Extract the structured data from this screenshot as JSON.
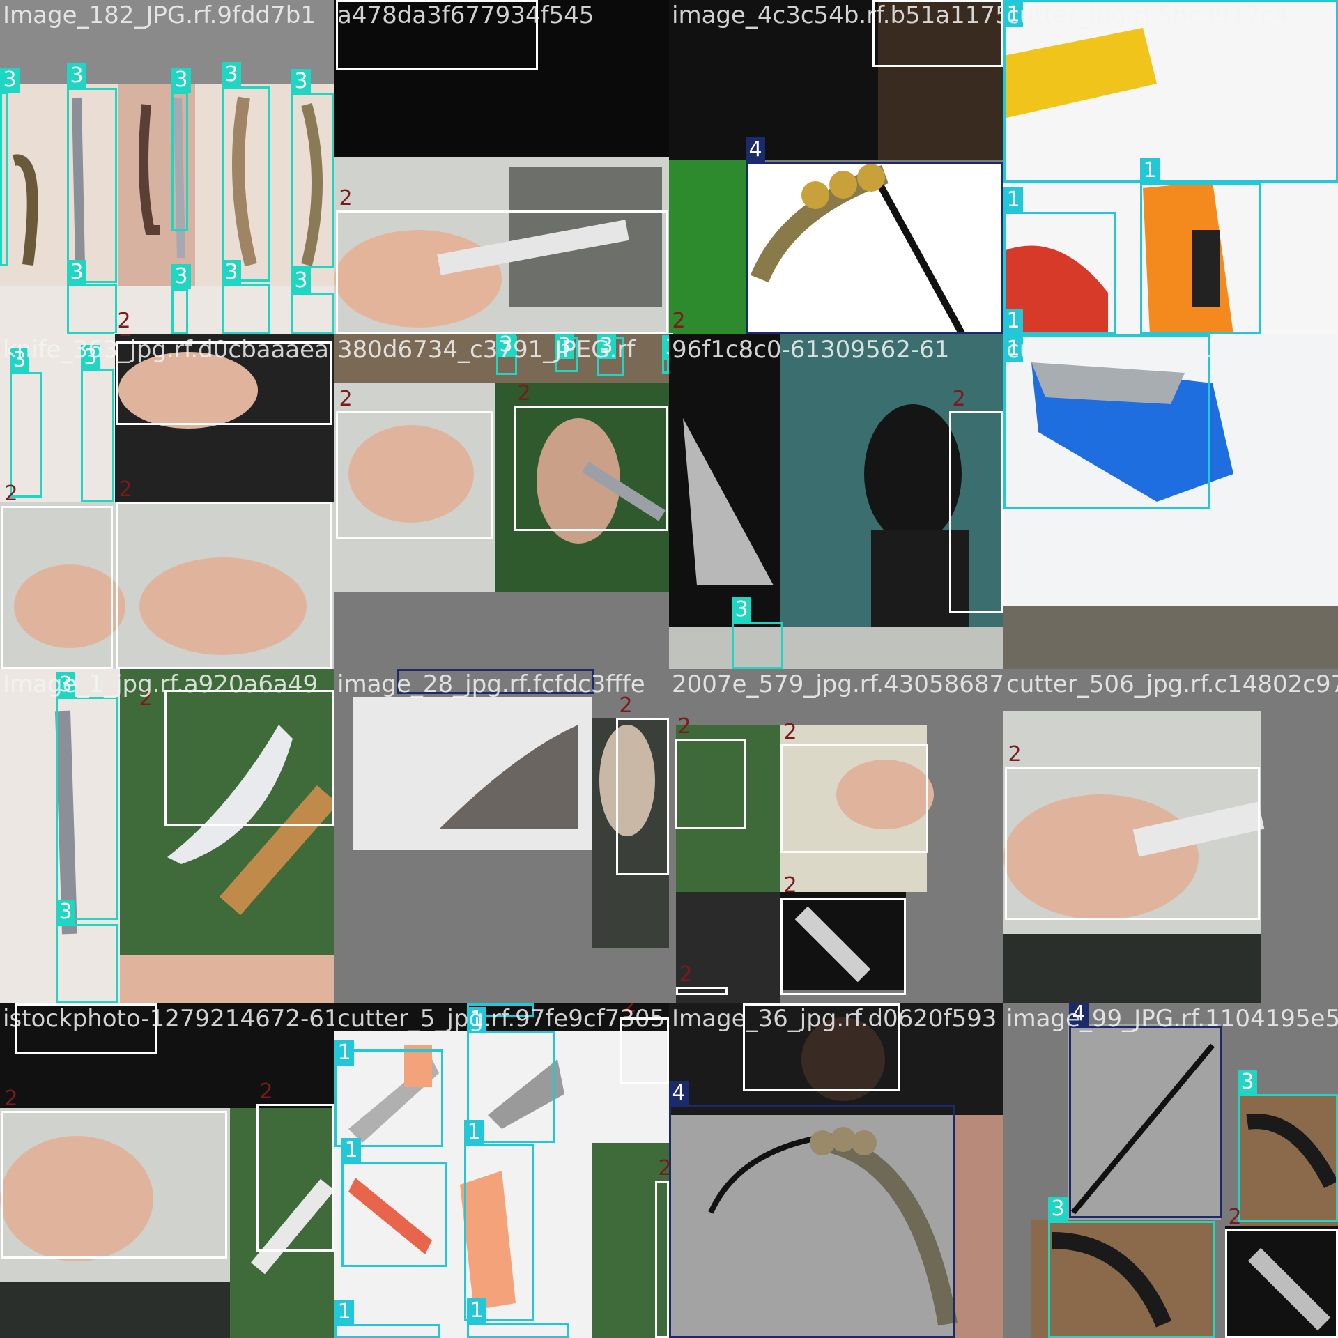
{
  "colors": {
    "class_1": "#22c8d8",
    "class_2": "#ffffff",
    "class_3": "#1fd6c2",
    "class_4": "#1a2a6c",
    "label_2_text": "#7a1c1c"
  },
  "tiles": [
    {
      "title": "Image_182_JPG.rf.9fdd7b1",
      "labels": [
        "3",
        "3",
        "3",
        "3",
        "3",
        "3",
        "3",
        "3",
        "3",
        "2"
      ]
    },
    {
      "title": "a478da3f677934f545",
      "labels": [
        "2",
        "2"
      ]
    },
    {
      "title": "image_4c3c54b.rf.b51a1175",
      "labels": [
        "2",
        "4",
        "2"
      ]
    },
    {
      "title": "cutter_jpg.rf.5bc3917c4",
      "labels": [
        "1",
        "1",
        "1",
        "1"
      ]
    },
    {
      "title": "knife_363_jpg.rf.d0cbaaaea",
      "labels": [
        "3",
        "3",
        "2",
        "2",
        "2"
      ]
    },
    {
      "title": "380d6734_c3791_JPEG.rf",
      "labels": [
        "3",
        "3",
        "3",
        "3",
        "2",
        "2"
      ]
    },
    {
      "title": "96f1c8c0-61309562-61",
      "labels": [
        "2",
        "3"
      ]
    },
    {
      "title": "cutter_04_jpg.rf.1fe22b1617",
      "labels": [
        "1"
      ]
    },
    {
      "title": "Image_1_jpg.rf.a920a6a49",
      "labels": [
        "3",
        "3",
        "2"
      ]
    },
    {
      "title": "image_28_jpg.rf.fcfdc3fffe",
      "labels": [
        "4",
        "2"
      ]
    },
    {
      "title": "2007e_579_jpg.rf.43058687a",
      "labels": [
        "2",
        "2",
        "2",
        "2"
      ]
    },
    {
      "title": "cutter_506_jpg.rf.c14802c97c5",
      "labels": [
        "2"
      ]
    },
    {
      "title": "istockphoto-1279214672-612",
      "labels": [
        "2",
        "2",
        "2"
      ]
    },
    {
      "title": "cutter_5_jpg.rf.97fe9cf7305",
      "labels": [
        "1",
        "1",
        "1",
        "1",
        "1",
        "1",
        "1",
        "2",
        "2"
      ]
    },
    {
      "title": "Image_36_jpg.rf.d0620f593",
      "labels": [
        "2",
        "4"
      ]
    },
    {
      "title": "image_99_JPG.rf.1104195e5",
      "labels": [
        "4",
        "3",
        "3",
        "2"
      ]
    }
  ]
}
